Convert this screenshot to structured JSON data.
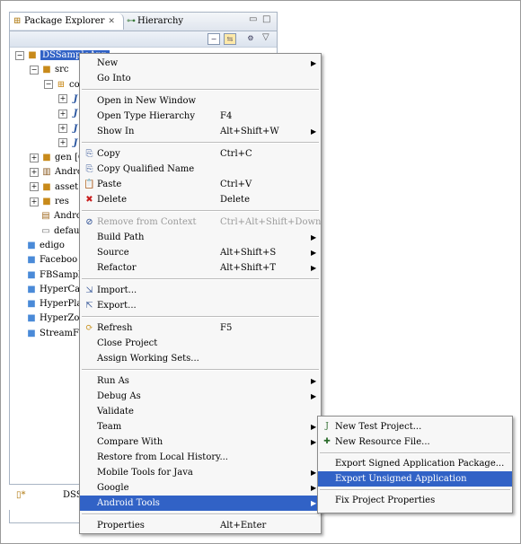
{
  "explorer": {
    "tab_active": "Package Explorer",
    "tab_close": "✕",
    "tab_inactive": "Hierarchy",
    "minimize": "▭",
    "maximize": "□",
    "view_menu": "▽",
    "tree": [
      {
        "label": "DSSampleApp",
        "depth": 0,
        "expander": "⊟",
        "icon": "project-icon",
        "glyph": "📁"
      },
      {
        "label": "src",
        "depth": 1,
        "expander": "⊟",
        "icon": "source-folder-icon",
        "glyph": "🗀"
      },
      {
        "label": "co",
        "depth": 2,
        "expander": "⊟",
        "icon": "package-icon",
        "glyph": "⊞"
      },
      {
        "label": "",
        "depth": 3,
        "expander": "⊞",
        "icon": "java-file-icon",
        "glyph": "J"
      },
      {
        "label": "",
        "depth": 3,
        "expander": "⊞",
        "icon": "java-file-icon",
        "glyph": "J"
      },
      {
        "label": "",
        "depth": 3,
        "expander": "⊞",
        "icon": "java-file-icon",
        "glyph": "J"
      },
      {
        "label": "",
        "depth": 3,
        "expander": "⊞",
        "icon": "java-file-icon",
        "glyph": "J"
      },
      {
        "label": "gen [G",
        "depth": 1,
        "expander": "⊞",
        "icon": "gen-folder-icon",
        "glyph": "🗀"
      },
      {
        "label": "Andro",
        "depth": 1,
        "expander": "⊞",
        "icon": "library-icon",
        "glyph": "📚"
      },
      {
        "label": "asset",
        "depth": 1,
        "expander": "⊞",
        "icon": "folder-icon",
        "glyph": "🗀"
      },
      {
        "label": "res",
        "depth": 1,
        "expander": "⊞",
        "icon": "folder-icon",
        "glyph": "🗀"
      },
      {
        "label": "Andro",
        "depth": 1,
        "expander": "",
        "icon": "manifest-icon",
        "glyph": "▤"
      },
      {
        "label": "defau",
        "depth": 1,
        "expander": "",
        "icon": "file-icon",
        "glyph": "▭"
      },
      {
        "label": "edigo",
        "depth": 0,
        "expander": "",
        "icon": "closed-project-icon",
        "glyph": "🗀"
      },
      {
        "label": "Faceboo",
        "depth": 0,
        "expander": "",
        "icon": "closed-project-icon",
        "glyph": "🗀"
      },
      {
        "label": "FBSampl",
        "depth": 0,
        "expander": "",
        "icon": "closed-project-icon",
        "glyph": "🗀"
      },
      {
        "label": "HyperCa",
        "depth": 0,
        "expander": "",
        "icon": "closed-project-icon",
        "glyph": "🗀"
      },
      {
        "label": "HyperPla",
        "depth": 0,
        "expander": "",
        "icon": "closed-project-icon",
        "glyph": "🗀"
      },
      {
        "label": "HyperZo",
        "depth": 0,
        "expander": "",
        "icon": "closed-project-icon",
        "glyph": "🗀"
      },
      {
        "label": "StreamF",
        "depth": 0,
        "expander": "",
        "icon": "closed-project-icon",
        "glyph": "🗀"
      }
    ]
  },
  "bottom_tab": "DSS",
  "menu": {
    "items": [
      {
        "label": "New",
        "key": "",
        "arrow": true
      },
      {
        "label": "Go Into",
        "key": ""
      },
      {
        "sep": true
      },
      {
        "label": "Open in New Window",
        "key": ""
      },
      {
        "label": "Open Type Hierarchy",
        "key": "F4"
      },
      {
        "label": "Show In",
        "key": "Alt+Shift+W",
        "arrow": true
      },
      {
        "sep": true
      },
      {
        "label": "Copy",
        "key": "Ctrl+C",
        "icon": "copy-icon",
        "glyph": "⎘"
      },
      {
        "label": "Copy Qualified Name",
        "key": "",
        "icon": "copy-qualified-icon",
        "glyph": "⎘"
      },
      {
        "label": "Paste",
        "key": "Ctrl+V",
        "icon": "paste-icon",
        "glyph": "📋"
      },
      {
        "label": "Delete",
        "key": "Delete",
        "icon": "delete-icon",
        "glyph": "✖"
      },
      {
        "sep": true
      },
      {
        "label": "Remove from Context",
        "key": "Ctrl+Alt+Shift+Down",
        "disabled": true,
        "icon": "remove-context-icon",
        "glyph": "⊘"
      },
      {
        "label": "Build Path",
        "key": "",
        "arrow": true
      },
      {
        "label": "Source",
        "key": "Alt+Shift+S",
        "arrow": true
      },
      {
        "label": "Refactor",
        "key": "Alt+Shift+T",
        "arrow": true
      },
      {
        "sep": true
      },
      {
        "label": "Import...",
        "key": "",
        "icon": "import-icon",
        "glyph": "⇲"
      },
      {
        "label": "Export...",
        "key": "",
        "icon": "export-icon",
        "glyph": "⇱"
      },
      {
        "sep": true
      },
      {
        "label": "Refresh",
        "key": "F5",
        "icon": "refresh-icon",
        "glyph": "⟳"
      },
      {
        "label": "Close Project",
        "key": ""
      },
      {
        "label": "Assign Working Sets...",
        "key": ""
      },
      {
        "sep": true
      },
      {
        "label": "Run As",
        "key": "",
        "arrow": true
      },
      {
        "label": "Debug As",
        "key": "",
        "arrow": true
      },
      {
        "label": "Validate",
        "key": ""
      },
      {
        "label": "Team",
        "key": "",
        "arrow": true
      },
      {
        "label": "Compare With",
        "key": "",
        "arrow": true
      },
      {
        "label": "Restore from Local History...",
        "key": ""
      },
      {
        "label": "Mobile Tools for Java",
        "key": "",
        "arrow": true
      },
      {
        "label": "Google",
        "key": "",
        "arrow": true
      },
      {
        "label": "Android Tools",
        "key": "",
        "arrow": true,
        "highlighted": true
      },
      {
        "sep": true
      },
      {
        "label": "Properties",
        "key": "Alt+Enter"
      }
    ]
  },
  "submenu": {
    "items": [
      {
        "label": "New Test Project...",
        "icon": "test-project-icon",
        "glyph": "J"
      },
      {
        "label": "New Resource File...",
        "icon": "resource-file-icon",
        "glyph": "✚"
      },
      {
        "sep": true
      },
      {
        "label": "Export Signed Application Package..."
      },
      {
        "label": "Export Unsigned Application Package...",
        "highlighted": true
      },
      {
        "sep": true
      },
      {
        "label": "Fix Project Properties"
      }
    ]
  },
  "arrow_glyph": "▶"
}
